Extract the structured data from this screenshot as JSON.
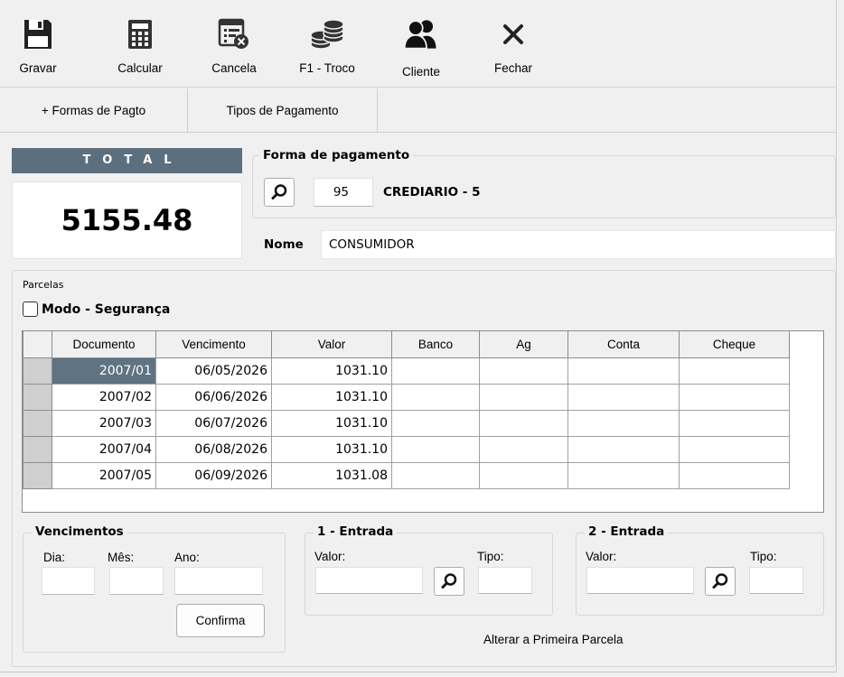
{
  "toolbar": {
    "gravar": "Gravar",
    "calcular": "Calcular",
    "cancela": "Cancela",
    "troco": "F1 - Troco",
    "cliente": "Cliente",
    "fechar": "Fechar"
  },
  "tabs": {
    "formas": "+ Formas de Pagto",
    "tipos": "Tipos de Pagamento"
  },
  "total": {
    "label": "TOTAL",
    "value": "5155.48"
  },
  "forma": {
    "title": "Forma de pagamento",
    "code": "95",
    "desc": "CREDIARIO - 5"
  },
  "nome": {
    "label": "Nome",
    "value": "CONSUMIDOR"
  },
  "parcelas": {
    "title": "Parcelas",
    "modo": "Modo - Segurança",
    "columns": [
      "Documento",
      "Vencimento",
      "Valor",
      "Banco",
      "Ag",
      "Conta",
      "Cheque"
    ],
    "rows": [
      {
        "doc": "2007/01",
        "venc": "06/05/2026",
        "valor": "1031.10"
      },
      {
        "doc": "2007/02",
        "venc": "06/06/2026",
        "valor": "1031.10"
      },
      {
        "doc": "2007/03",
        "venc": "06/07/2026",
        "valor": "1031.10"
      },
      {
        "doc": "2007/04",
        "venc": "06/08/2026",
        "valor": "1031.10"
      },
      {
        "doc": "2007/05",
        "venc": "06/09/2026",
        "valor": "1031.08"
      }
    ]
  },
  "vencimentos": {
    "title": "Vencimentos",
    "dia": "Dia:",
    "mes": "Mês:",
    "ano": "Ano:",
    "confirma": "Confirma"
  },
  "entrada1": {
    "title": "1 - Entrada",
    "valor": "Valor:",
    "tipo": "Tipo:"
  },
  "entrada2": {
    "title": "2 - Entrada",
    "valor": "Valor:",
    "tipo": "Tipo:"
  },
  "alterar": "Alterar a Primeira Parcela"
}
